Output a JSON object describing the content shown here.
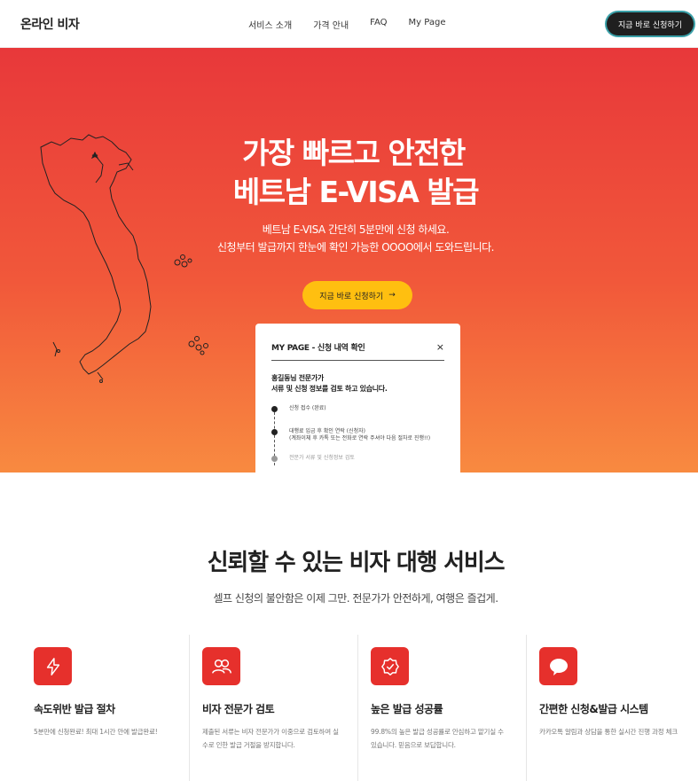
{
  "header": {
    "logo": "온라인 비자",
    "nav": [
      "서비스 소개",
      "가격 안내",
      "FAQ",
      "My Page"
    ],
    "cta": "지금 바로 신청하기"
  },
  "hero": {
    "title_line1": "가장 빠르고 안전한",
    "title_line2": "베트남 E-VISA 발급",
    "sub_line1": "베트남 E-VISA 간단히 5분만에 신청 하세요.",
    "sub_line2": "신청부터 발급까지 한눈에 확인 가능한 OOOO에서 도와드립니다.",
    "cta": "지금 바로 신청하기",
    "cta_arrow": "→"
  },
  "card": {
    "title": "MY PAGE - 신청 내역 확인",
    "close": "×",
    "message_line1": "홍길동님 전문가가",
    "message_line2": "서류 및 신청 정보를 검토 하고 있습니다.",
    "steps": [
      {
        "line1": "신청 접수 (완료)",
        "line2": ""
      },
      {
        "line1": "대행료 입금 후 확인 연락 (신청자)",
        "line2": "(계좌이체 후 카톡 또는 전화로 연락 주셔야 다음 절차로 진행!!)"
      },
      {
        "line1": "전문가 서류 및 신청정보 검토",
        "line2": ""
      }
    ]
  },
  "section": {
    "title": "신뢰할 수 있는 비자 대행 서비스",
    "subtitle": "셀프 신청의 불안함은 이제 그만. 전문가가 안전하게, 여행은 즐겁게."
  },
  "features": [
    {
      "icon": "lightning-icon",
      "title": "속도위반 발급 절차",
      "desc": "5분만에 신청완료! 최대 1시간 안에 발급완료!"
    },
    {
      "icon": "users-icon",
      "title": "비자 전문가 검토",
      "desc": "제출된 서류는 비자 전문가가 이중으로 검토하여 실수로 인한 발급 거절을 방지합니다."
    },
    {
      "icon": "badge-check-icon",
      "title": "높은 발급 성공률",
      "desc": "99.8%의 높은 발급 성공률로 안심하고 맡기실 수 있습니다. 믿음으로 보답합니다."
    },
    {
      "icon": "kakaotalk-icon",
      "title": "간편한 신청&발급 시스템",
      "desc": "카카오톡 알림과 상담을 통한 실시간 진행 과정 체크"
    }
  ],
  "colors": {
    "accent_red": "#e6302c",
    "cta_yellow": "#ffbf10",
    "dark_button": "#1f1f1f"
  }
}
